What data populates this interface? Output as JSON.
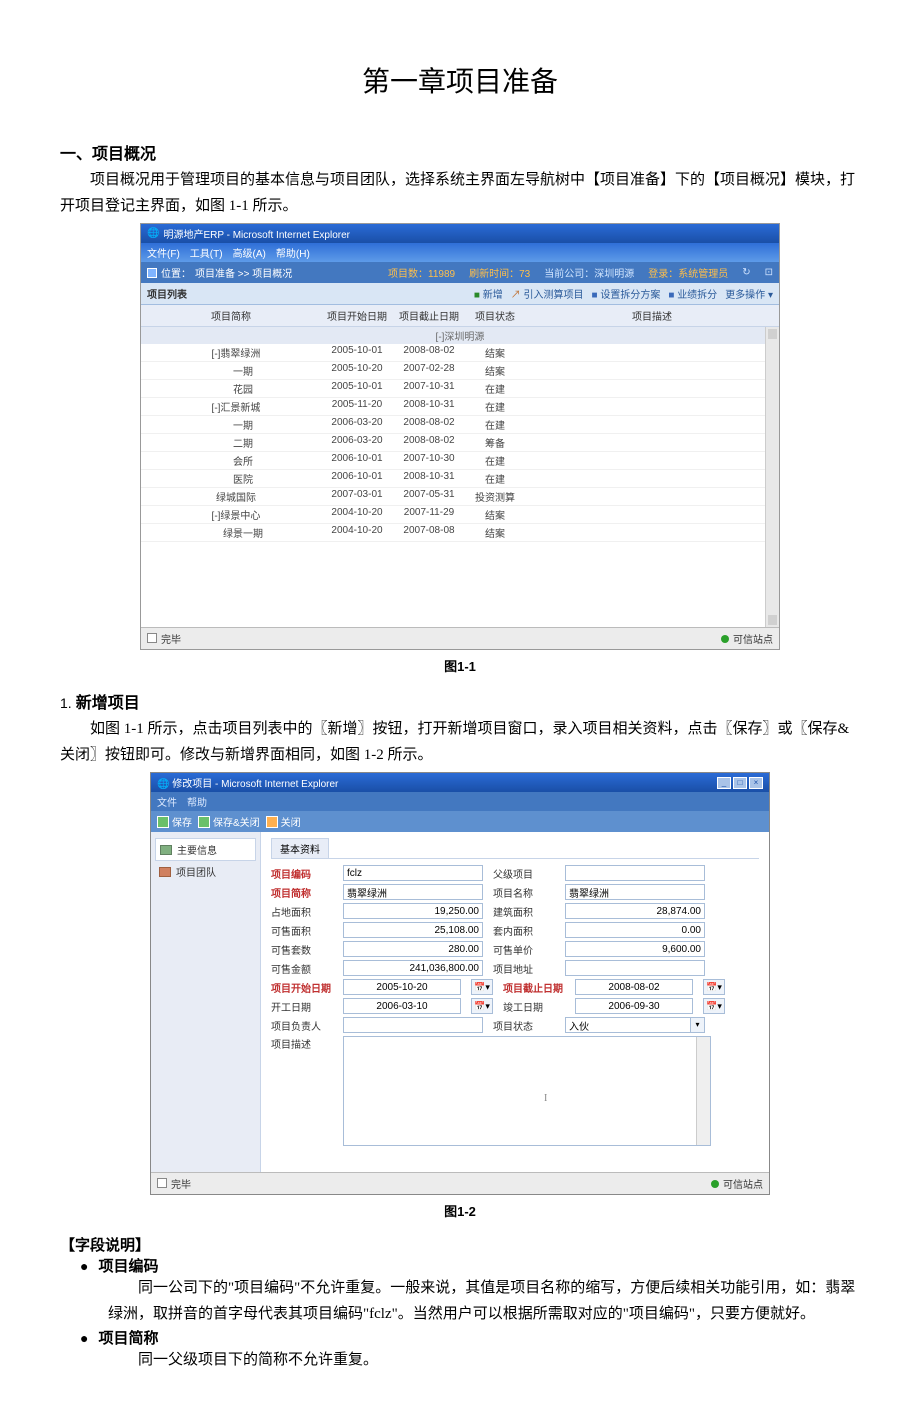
{
  "doc": {
    "chapter_title": "第一章项目准备",
    "h2_1": "一、项目概况",
    "p1": "项目概况用于管理项目的基本信息与项目团队，选择系统主界面左导航树中【项目准备】下的【项目概况】模块，打开项目登记主界面，如图 1-1 所示。",
    "fig1_caption": "图1-1",
    "h3_1_num": "1.",
    "h3_1": "新增项目",
    "p2": "如图 1-1 所示，点击项目列表中的〖新增〗按钮，打开新增项目窗口，录入项目相关资料，点击〖保存〗或〖保存&关闭〗按钮即可。修改与新增界面相同，如图 1-2 所示。",
    "fig2_caption": "图1-2",
    "fieldspec_header": "【字段说明】",
    "bullet1_title": "项目编码",
    "bullet1_para": "同一公司下的\"项目编码\"不允许重复。一般来说，其值是项目名称的缩写，方便后续相关功能引用，如：翡翠绿洲，取拼音的首字母代表其项目编码\"fclz\"。当然用户可以根据所需取对应的\"项目编码\"，只要方便就好。",
    "bullet2_title": "项目简称",
    "bullet2_para": "同一父级项目下的简称不允许重复。"
  },
  "ss1": {
    "title": "明源地产ERP - Microsoft Internet Explorer",
    "menus": [
      "文件(F)",
      "工具(T)",
      "高级(A)",
      "帮助(H)"
    ],
    "loc_prefix": "位置：",
    "crumb": "项目准备 >> 项目概况",
    "info_items": "项目数：11989",
    "info_update": "刷新时间：73",
    "info_company": "当前公司：深圳明源",
    "info_login": "登录：系统管理员",
    "listpanel_title": "项目列表",
    "toolbar_btns": [
      "新增",
      "引入测算项目",
      "设置拆分方案",
      "业绩拆分",
      "更多操作"
    ],
    "cols": [
      "项目简称",
      "项目开始日期",
      "项目截止日期",
      "项目状态",
      "项目描述"
    ],
    "group_label": "[-]深圳明源",
    "rows": [
      {
        "name": "[-]翡翠绿洲",
        "start": "2005-10-01",
        "end": "2008-08-02",
        "status": "结案"
      },
      {
        "name": "一期",
        "indent": 1,
        "start": "2005-10-20",
        "end": "2007-02-28",
        "status": "结案"
      },
      {
        "name": "花园",
        "indent": 1,
        "start": "2005-10-01",
        "end": "2007-10-31",
        "status": "在建"
      },
      {
        "name": "[-]汇景新城",
        "start": "2005-11-20",
        "end": "2008-10-31",
        "status": "在建"
      },
      {
        "name": "一期",
        "indent": 1,
        "start": "2006-03-20",
        "end": "2008-08-02",
        "status": "在建"
      },
      {
        "name": "二期",
        "indent": 1,
        "start": "2006-03-20",
        "end": "2008-08-02",
        "status": "筹备"
      },
      {
        "name": "会所",
        "indent": 1,
        "start": "2006-10-01",
        "end": "2007-10-30",
        "status": "在建"
      },
      {
        "name": "医院",
        "indent": 1,
        "start": "2006-10-01",
        "end": "2008-10-31",
        "status": "在建"
      },
      {
        "name": "绿城国际",
        "start": "2007-03-01",
        "end": "2007-05-31",
        "status": "投资测算"
      },
      {
        "name": "[-]绿景中心",
        "start": "2004-10-20",
        "end": "2007-11-29",
        "status": "结案"
      },
      {
        "name": "绿景一期",
        "indent": 1,
        "start": "2004-10-20",
        "end": "2007-08-08",
        "status": "结案"
      }
    ],
    "status_done": "完毕",
    "status_trust": "可信站点"
  },
  "ss2": {
    "title": "修改项目 - Microsoft Internet Explorer",
    "menus": [
      "文件",
      "帮助"
    ],
    "toolbar": {
      "save": "保存",
      "save_close": "保存&关闭",
      "close": "关闭"
    },
    "sidebar": {
      "main": "主要信息",
      "team": "项目团队"
    },
    "tab": "基本资料",
    "labels": {
      "code": "项目编码",
      "parent": "父级项目",
      "short": "项目简称",
      "name": "项目名称",
      "land": "占地面积",
      "build": "建筑面积",
      "salearea": "可售面积",
      "inside": "套内面积",
      "units": "可售套数",
      "unitprice": "可售单价",
      "amount": "可售金额",
      "addr": "项目地址",
      "start": "项目开始日期",
      "deadline": "项目截止日期",
      "begin": "开工日期",
      "end": "竣工日期",
      "owner": "项目负责人",
      "status": "项目状态",
      "desc": "项目描述"
    },
    "values": {
      "code": "fclz",
      "parent": "",
      "short": "翡翠绿洲",
      "name": "翡翠绿洲",
      "land": "19,250.00",
      "build": "28,874.00",
      "salearea": "25,108.00",
      "inside": "0.00",
      "units": "280.00",
      "unitprice": "9,600.00",
      "amount": "241,036,800.00",
      "addr": "",
      "start": "2005-10-20",
      "deadline": "2008-08-02",
      "begin": "2006-03-10",
      "end": "2006-09-30",
      "owner": "",
      "status": "入伙",
      "desc": ""
    },
    "status_done": "完毕",
    "status_trust": "可信站点"
  }
}
